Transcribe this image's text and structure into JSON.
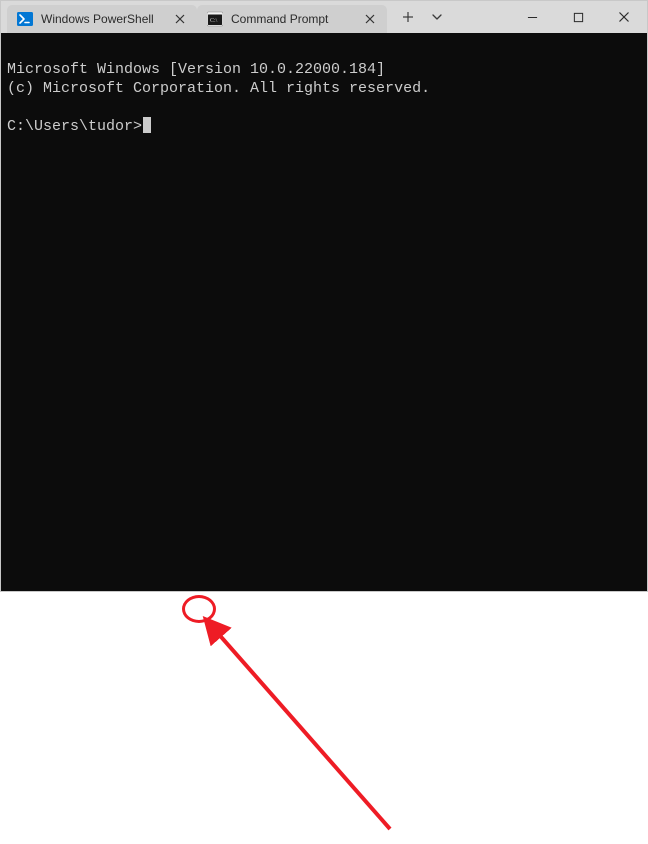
{
  "tabs": [
    {
      "label": "Windows PowerShell",
      "icon": "powershell"
    },
    {
      "label": "Command Prompt",
      "icon": "cmd"
    }
  ],
  "terminal": {
    "line1": "Microsoft Windows [Version 10.0.22000.184]",
    "line2": "(c) Microsoft Corporation. All rights reserved.",
    "prompt": "C:\\Users\\tudor>"
  }
}
